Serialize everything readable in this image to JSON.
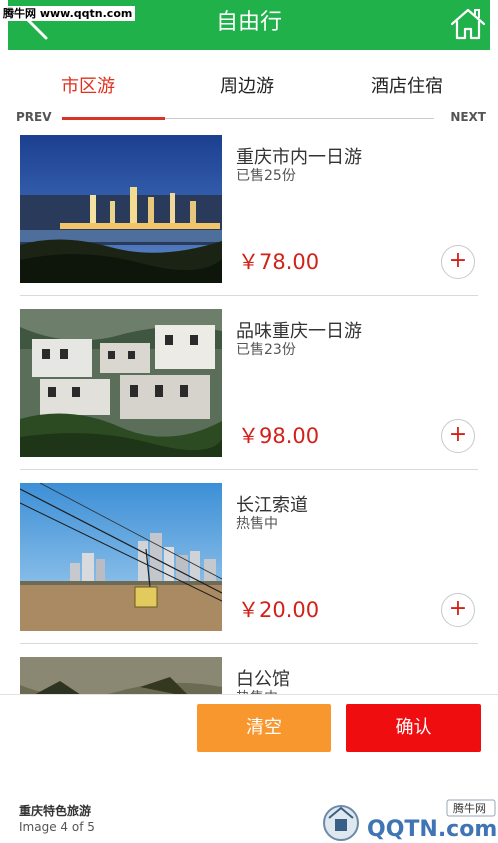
{
  "watermark": {
    "top_left": "腾牛网 www.qqtn.com"
  },
  "header": {
    "title": "自由行",
    "back_icon": "back-arrow-icon",
    "home_icon": "home-icon"
  },
  "tabs": [
    {
      "label": "市区游",
      "active": true
    },
    {
      "label": "周边游",
      "active": false
    },
    {
      "label": "酒店住宿",
      "active": false
    }
  ],
  "pager": {
    "prev": "PREV",
    "next": "NEXT"
  },
  "items": [
    {
      "name": "重庆市内一日游",
      "sub": "已售25份",
      "price": "￥78.00",
      "add": "+"
    },
    {
      "name": "品味重庆一日游",
      "sub": "已售23份",
      "price": "￥98.00",
      "add": "+"
    },
    {
      "name": "长江索道",
      "sub": "热售中",
      "price": "￥20.00",
      "add": "+"
    },
    {
      "name": "白公馆",
      "sub": "热售中",
      "price": "",
      "add": "+"
    }
  ],
  "bottom_bar": {
    "clear": "清空",
    "confirm": "确认"
  },
  "caption": {
    "title": "重庆特色旅游",
    "count": "Image 4 of 5"
  },
  "logo": {
    "text": "QQTN.com",
    "badge": "腾牛网"
  },
  "colors": {
    "header": "#21b14b",
    "accent_red": "#d3211a",
    "clear_button": "#f8972e",
    "confirm_button": "#f00d0f"
  }
}
